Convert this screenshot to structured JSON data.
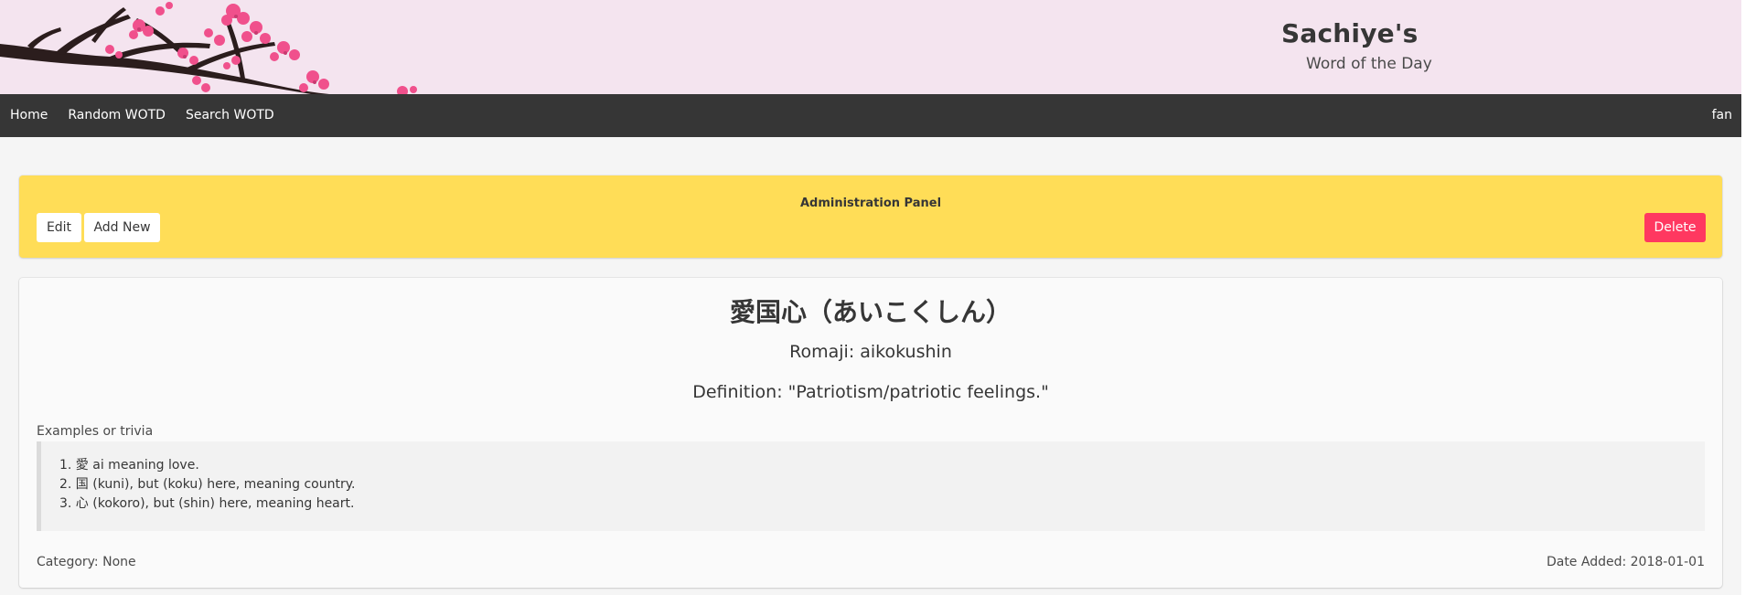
{
  "header": {
    "title": "Sachiye's",
    "subtitle": "Word of the Day",
    "colors": {
      "banner_bg": "#f4e4ef",
      "blossom": "#f0508c",
      "branch": "#2b1d1d"
    }
  },
  "navbar": {
    "items": [
      {
        "label": "Home"
      },
      {
        "label": "Random WOTD"
      },
      {
        "label": "Search WOTD"
      }
    ],
    "user": "fan"
  },
  "admin": {
    "title": "Administration Panel",
    "edit_label": "Edit",
    "add_label": "Add New",
    "delete_label": "Delete",
    "colors": {
      "panel": "#ffdd57",
      "delete": "#ff3860"
    }
  },
  "word": {
    "title": "愛国心（あいこくしん）",
    "romaji": "Romaji: aikokushin",
    "definition": "Definition: \"Patriotism/patriotic feelings.\"",
    "examples_label": "Examples or trivia",
    "examples": [
      "1. 愛 ai meaning love.",
      "2. 国 (kuni), but (koku) here, meaning country.",
      "3. 心 (kokoro), but (shin) here, meaning heart."
    ],
    "category": "Category: None",
    "date_added": "Date Added: 2018-01-01"
  }
}
